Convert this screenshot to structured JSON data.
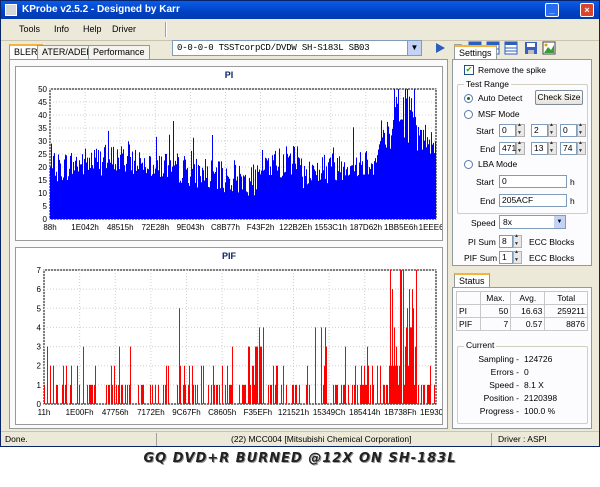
{
  "window": {
    "title": "KProbe v2.5.2 - Designed by Karr"
  },
  "menu": [
    "Tools",
    "Info",
    "Help",
    "Driver"
  ],
  "drive": "0-0-0-0 TSSTcorpCD/DVDW SH-S183L SB03",
  "tabs": [
    "BLER",
    "ATER/ADER",
    "Performance"
  ],
  "graphs": {
    "pi": {
      "title": "PI",
      "yticks": [
        "50",
        "45",
        "40",
        "35",
        "30",
        "25",
        "20",
        "15",
        "10",
        "5",
        "0"
      ],
      "xticks": [
        "88h",
        "1E042h",
        "48515h",
        "72E28h",
        "9E043h",
        "C8B77h",
        "F43F2h",
        "122B2Eh",
        "1553C1h",
        "187D62h",
        "1BB5E6h",
        "1EEE6Bh"
      ]
    },
    "pif": {
      "title": "PIF",
      "yticks": [
        "7",
        "6",
        "5",
        "4",
        "3",
        "2",
        "1",
        "0"
      ],
      "xticks": [
        "11h",
        "1E00Fh",
        "47756h",
        "7172Eh",
        "9C67Fh",
        "C8605h",
        "F35EFh",
        "121521h",
        "15349Ch",
        "185414h",
        "1B738Fh",
        "1E9307h"
      ]
    }
  },
  "chart_data": [
    {
      "type": "bar",
      "title": "PI",
      "xlabel": "",
      "ylabel": "",
      "ylim": [
        0,
        50
      ],
      "x_range": [
        "88h",
        "1EEE6Bh"
      ],
      "max": 50,
      "average": 16.63,
      "total": 259211,
      "color": "#0000ff",
      "grid": true
    },
    {
      "type": "bar",
      "title": "PIF",
      "xlabel": "",
      "ylabel": "",
      "ylim": [
        0,
        7
      ],
      "x_range": [
        "11h",
        "1E9307h"
      ],
      "max": 7,
      "average": 0.57,
      "total": 8876,
      "color": "#ff0000",
      "grid": true
    }
  ],
  "settings": {
    "tab": "Settings",
    "remove_spike": "Remove the spike",
    "test_range": "Test Range",
    "auto_detect": "Auto Detect",
    "check_size": "Check Size",
    "msf_mode": "MSF Mode",
    "start": "Start",
    "end": "End",
    "msf_start": [
      "0",
      "2",
      "0"
    ],
    "msf_end": [
      "471",
      "13",
      "74"
    ],
    "lba_mode": "LBA Mode",
    "lba_start": "0",
    "lba_end": "205ACF",
    "h": "h",
    "speed_label": "Speed",
    "speed": "8x",
    "pi_sum_label": "PI Sum",
    "pi_sum": "8",
    "pif_sum_label": "PIF Sum",
    "pif_sum": "1",
    "ecc_blocks": "ECC Blocks"
  },
  "status": {
    "tab": "Status",
    "headers": [
      "",
      "Max.",
      "Avg.",
      "Total"
    ],
    "rows": [
      [
        "PI",
        "50",
        "16.63",
        "259211"
      ],
      [
        "PIF",
        "7",
        "0.57",
        "8876"
      ]
    ],
    "current": "Current",
    "sampling_label": "Sampling -",
    "sampling": "124726",
    "errors_label": "Errors -",
    "errors": "0",
    "speed_label": "Speed -",
    "speed": "8.1 X",
    "position_label": "Position -",
    "position": "2120398",
    "progress_label": "Progress -",
    "progress": "100.0 %"
  },
  "statusbar": {
    "left": "Done.",
    "center": "(22) MCC004 [Mitsubishi Chemical Corporation]",
    "right": "Driver : ASPI"
  },
  "caption": "GQ DVD+R BURNED @12X ON SH-183L"
}
